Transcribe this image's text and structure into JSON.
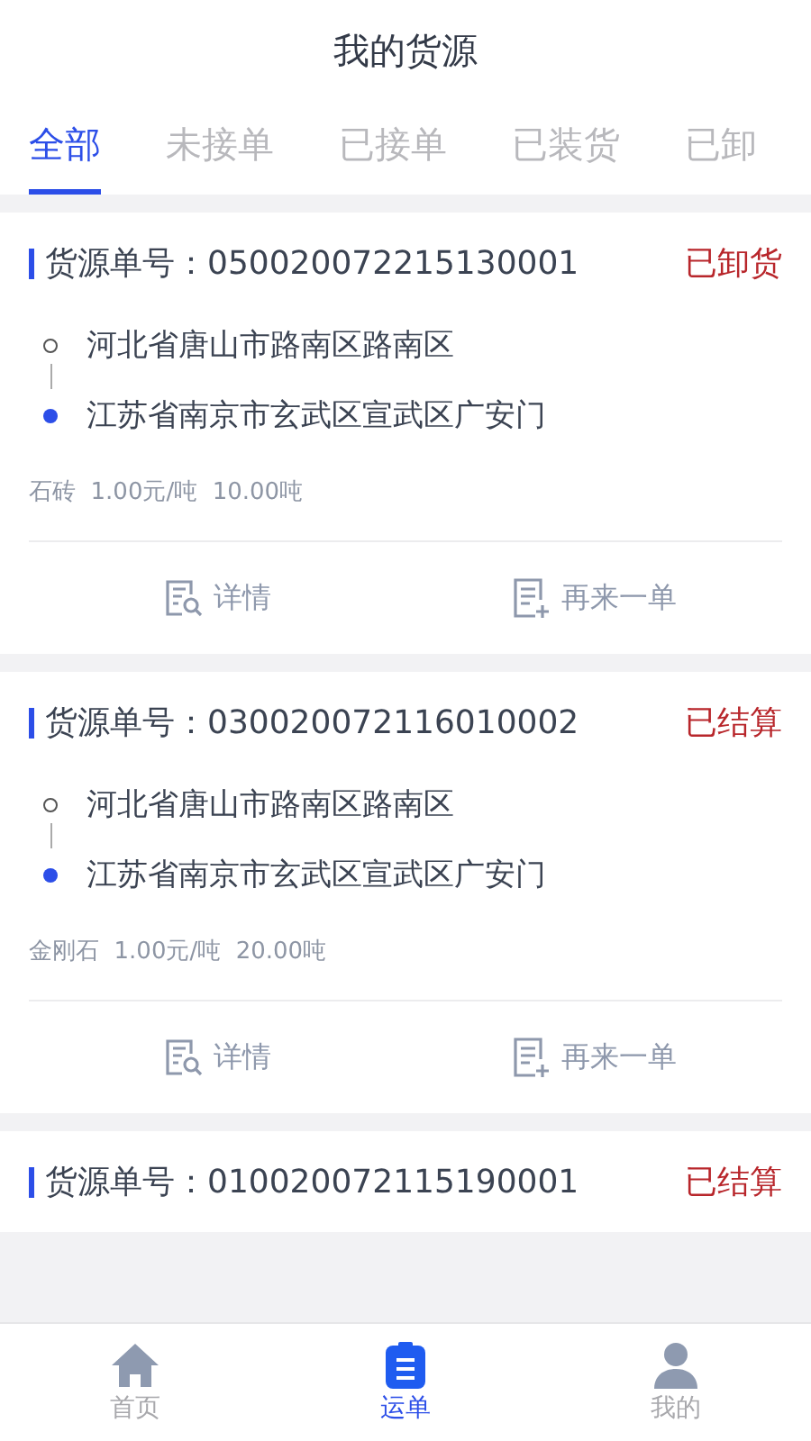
{
  "header": {
    "title": "我的货源"
  },
  "tabs": [
    {
      "label": "全部",
      "selected": true
    },
    {
      "label": "未接单",
      "selected": false
    },
    {
      "label": "已接单",
      "selected": false
    },
    {
      "label": "已装货",
      "selected": false
    },
    {
      "label": "已卸",
      "selected": false
    }
  ],
  "orders": [
    {
      "number_label": "货源单号：",
      "number": "050020072215130001",
      "status": "已卸货",
      "stops": [
        {
          "kind": "origin",
          "address": "河北省唐山市路南区路南区"
        },
        {
          "kind": "destination",
          "address": "江苏省南京市玄武区宣武区广安门"
        }
      ],
      "goods": "石砖  1.00元/吨  10.00吨",
      "actions": [
        {
          "kind": "detail",
          "label": "详情"
        },
        {
          "kind": "reorder",
          "label": "再来一单"
        }
      ]
    },
    {
      "number_label": "货源单号：",
      "number": "030020072116010002",
      "status": "已结算",
      "stops": [
        {
          "kind": "origin",
          "address": "河北省唐山市路南区路南区"
        },
        {
          "kind": "destination",
          "address": "江苏省南京市玄武区宣武区广安门"
        }
      ],
      "goods": "金刚石  1.00元/吨  20.00吨",
      "actions": [
        {
          "kind": "detail",
          "label": "详情"
        },
        {
          "kind": "reorder",
          "label": "再来一单"
        }
      ]
    },
    {
      "number_label": "货源单号：",
      "number": "010020072115190001",
      "status": "已结算"
    }
  ],
  "bottom_nav": [
    {
      "kind": "home",
      "label": "首页",
      "selected": false
    },
    {
      "kind": "waybill",
      "label": "运单",
      "selected": true
    },
    {
      "kind": "profile",
      "label": "我的",
      "selected": false
    }
  ]
}
